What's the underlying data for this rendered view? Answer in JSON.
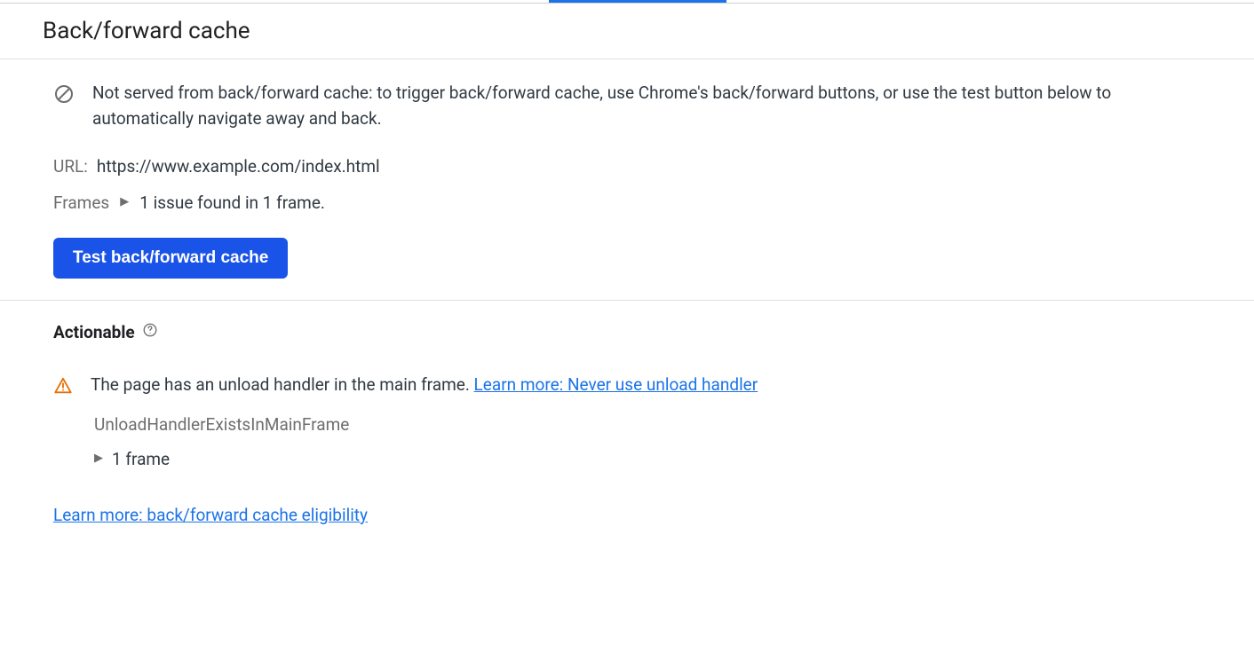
{
  "header": {
    "title": "Back/forward cache"
  },
  "info": {
    "message": "Not served from back/forward cache: to trigger back/forward cache, use Chrome's back/forward buttons, or use the test button below to automatically navigate away and back."
  },
  "url": {
    "label": "URL:",
    "value": "https://www.example.com/index.html"
  },
  "frames": {
    "label": "Frames",
    "summary": "1 issue found in 1 frame."
  },
  "buttons": {
    "test": "Test back/forward cache"
  },
  "actionable": {
    "title": "Actionable",
    "issue": {
      "text": "The page has an unload handler in the main frame. ",
      "link": "Learn more: Never use unload handler",
      "code": "UnloadHandlerExistsInMainFrame",
      "frames": "1 frame"
    },
    "learnMore": "Learn more: back/forward cache eligibility"
  }
}
